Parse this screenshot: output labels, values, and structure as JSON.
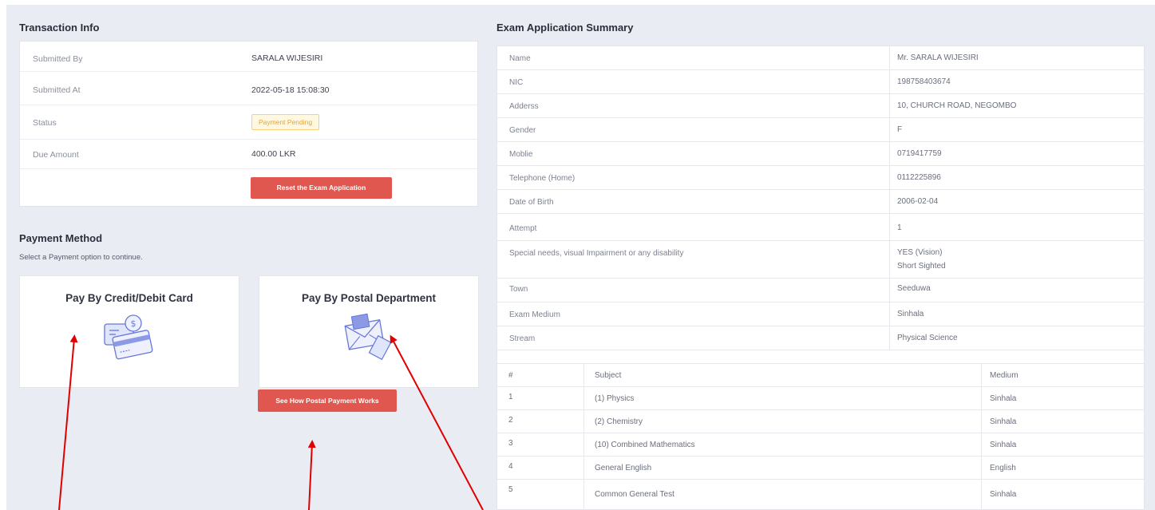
{
  "transaction": {
    "title": "Transaction Info",
    "rows": [
      {
        "label": "Submitted By",
        "value": "SARALA WIJESIRI"
      },
      {
        "label": "Submitted At",
        "value": "2022-05-18 15:08:30"
      },
      {
        "label": "Status",
        "value": "Payment Pending"
      },
      {
        "label": "Due Amount",
        "value": "400.00 LKR"
      }
    ],
    "reset_button": "Reset the Exam Application"
  },
  "payment": {
    "title": "Payment Method",
    "subtitle": "Select a Payment option to continue.",
    "card_option": "Pay By Credit/Debit Card",
    "postal_option": "Pay By Postal Department",
    "postal_help_button": "See How Postal Payment Works"
  },
  "summary": {
    "title": "Exam Application Summary",
    "rows": [
      {
        "label": "Name",
        "value": "Mr. SARALA WIJESIRI"
      },
      {
        "label": "NIC",
        "value": "198758403674"
      },
      {
        "label": "Adderss",
        "value": "10, CHURCH ROAD, NEGOMBO"
      },
      {
        "label": "Gender",
        "value": "F"
      },
      {
        "label": "Moblie",
        "value": "0719417759"
      },
      {
        "label": "Telephone (Home)",
        "value": "0112225896"
      },
      {
        "label": "Date of Birth",
        "value": "2006-02-04"
      },
      {
        "label": "Attempt",
        "value": "1"
      },
      {
        "label": "Special needs, visual Impairment or any disability",
        "value": "YES (Vision)",
        "value2": "Short Sighted"
      },
      {
        "label": "Town",
        "value": "Seeduwa"
      },
      {
        "label": "Exam Medium",
        "value": "Sinhala"
      },
      {
        "label": "Stream",
        "value": "Physical Science"
      }
    ],
    "subjects_header": {
      "num": "#",
      "subject": "Subject",
      "medium": "Medium"
    },
    "subjects": [
      {
        "num": "1",
        "subject": "(1) Physics",
        "medium": "Sinhala"
      },
      {
        "num": "2",
        "subject": "(2) Chemistry",
        "medium": "Sinhala"
      },
      {
        "num": "3",
        "subject": "(10) Combined Mathematics",
        "medium": "Sinhala"
      },
      {
        "num": "4",
        "subject": "General English",
        "medium": "English"
      },
      {
        "num": "5",
        "subject": "Common General Test",
        "medium": "Sinhala"
      }
    ]
  },
  "colors": {
    "accent_red": "#e0574f",
    "badge_yellow": "#e6a23c",
    "annotation_arrow": "#e00000"
  },
  "icons": [
    "credit-card-icon",
    "postal-envelope-icon",
    "annotation-arrow"
  ]
}
